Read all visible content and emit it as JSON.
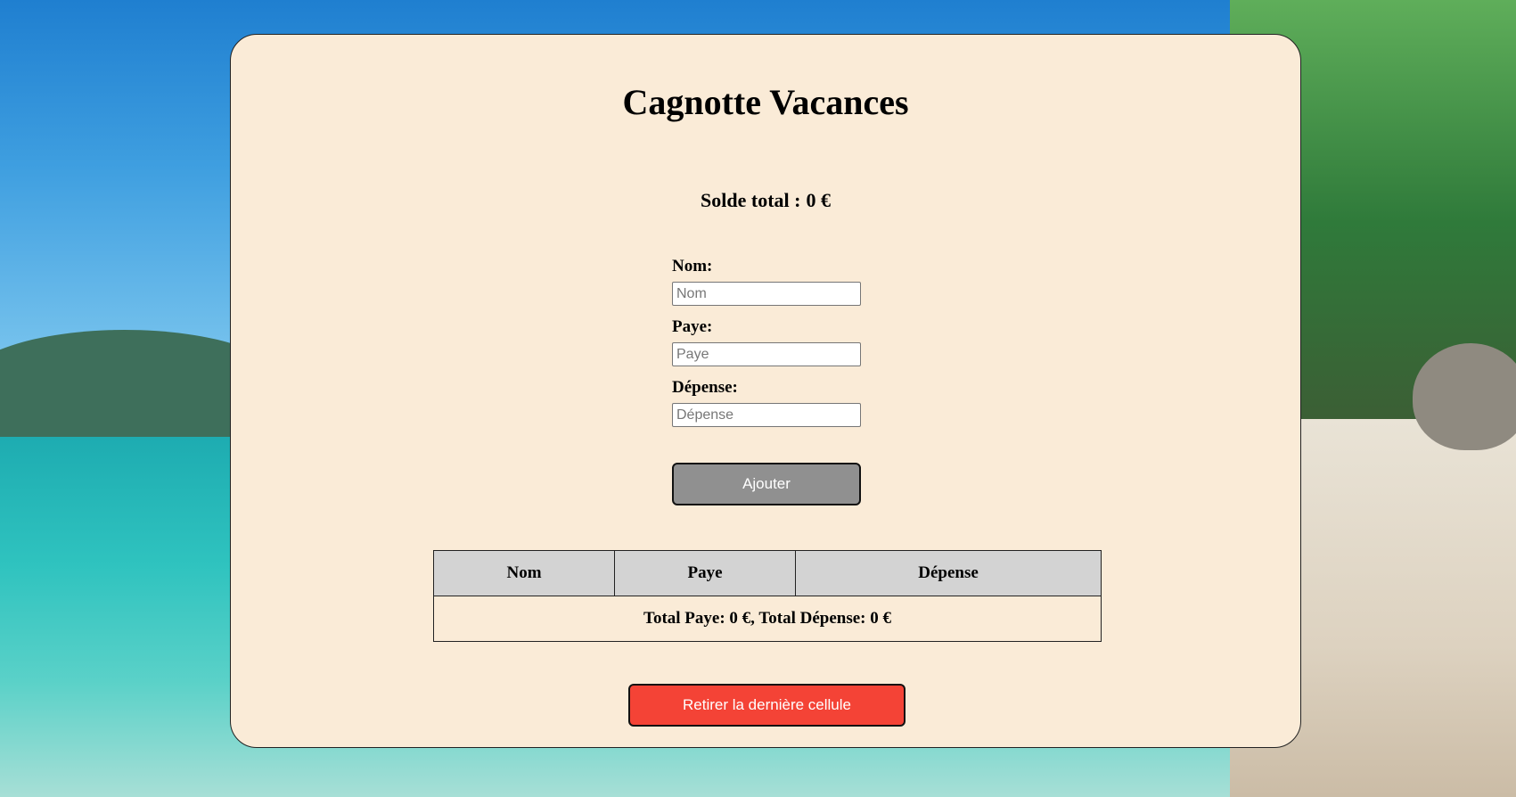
{
  "app": {
    "title": "Cagnotte Vacances"
  },
  "balance": {
    "label": "Solde total :",
    "amount": "0 €"
  },
  "form": {
    "name_label": "Nom:",
    "name_placeholder": "Nom",
    "name_value": "",
    "pay_label": "Paye:",
    "pay_placeholder": "Paye",
    "pay_value": "",
    "expense_label": "Dépense:",
    "expense_placeholder": "Dépense",
    "expense_value": "",
    "add_button_label": "Ajouter"
  },
  "table": {
    "headers": [
      "Nom",
      "Paye",
      "Dépense"
    ],
    "footer": "Total Paye: 0 €, Total Dépense: 0 €"
  },
  "actions": {
    "remove_button_label": "Retirer la dernière cellule"
  },
  "colors": {
    "card_background": "#faebd7",
    "add_button": "#909090",
    "remove_button": "#f44336",
    "table_header": "#d3d3d3"
  }
}
